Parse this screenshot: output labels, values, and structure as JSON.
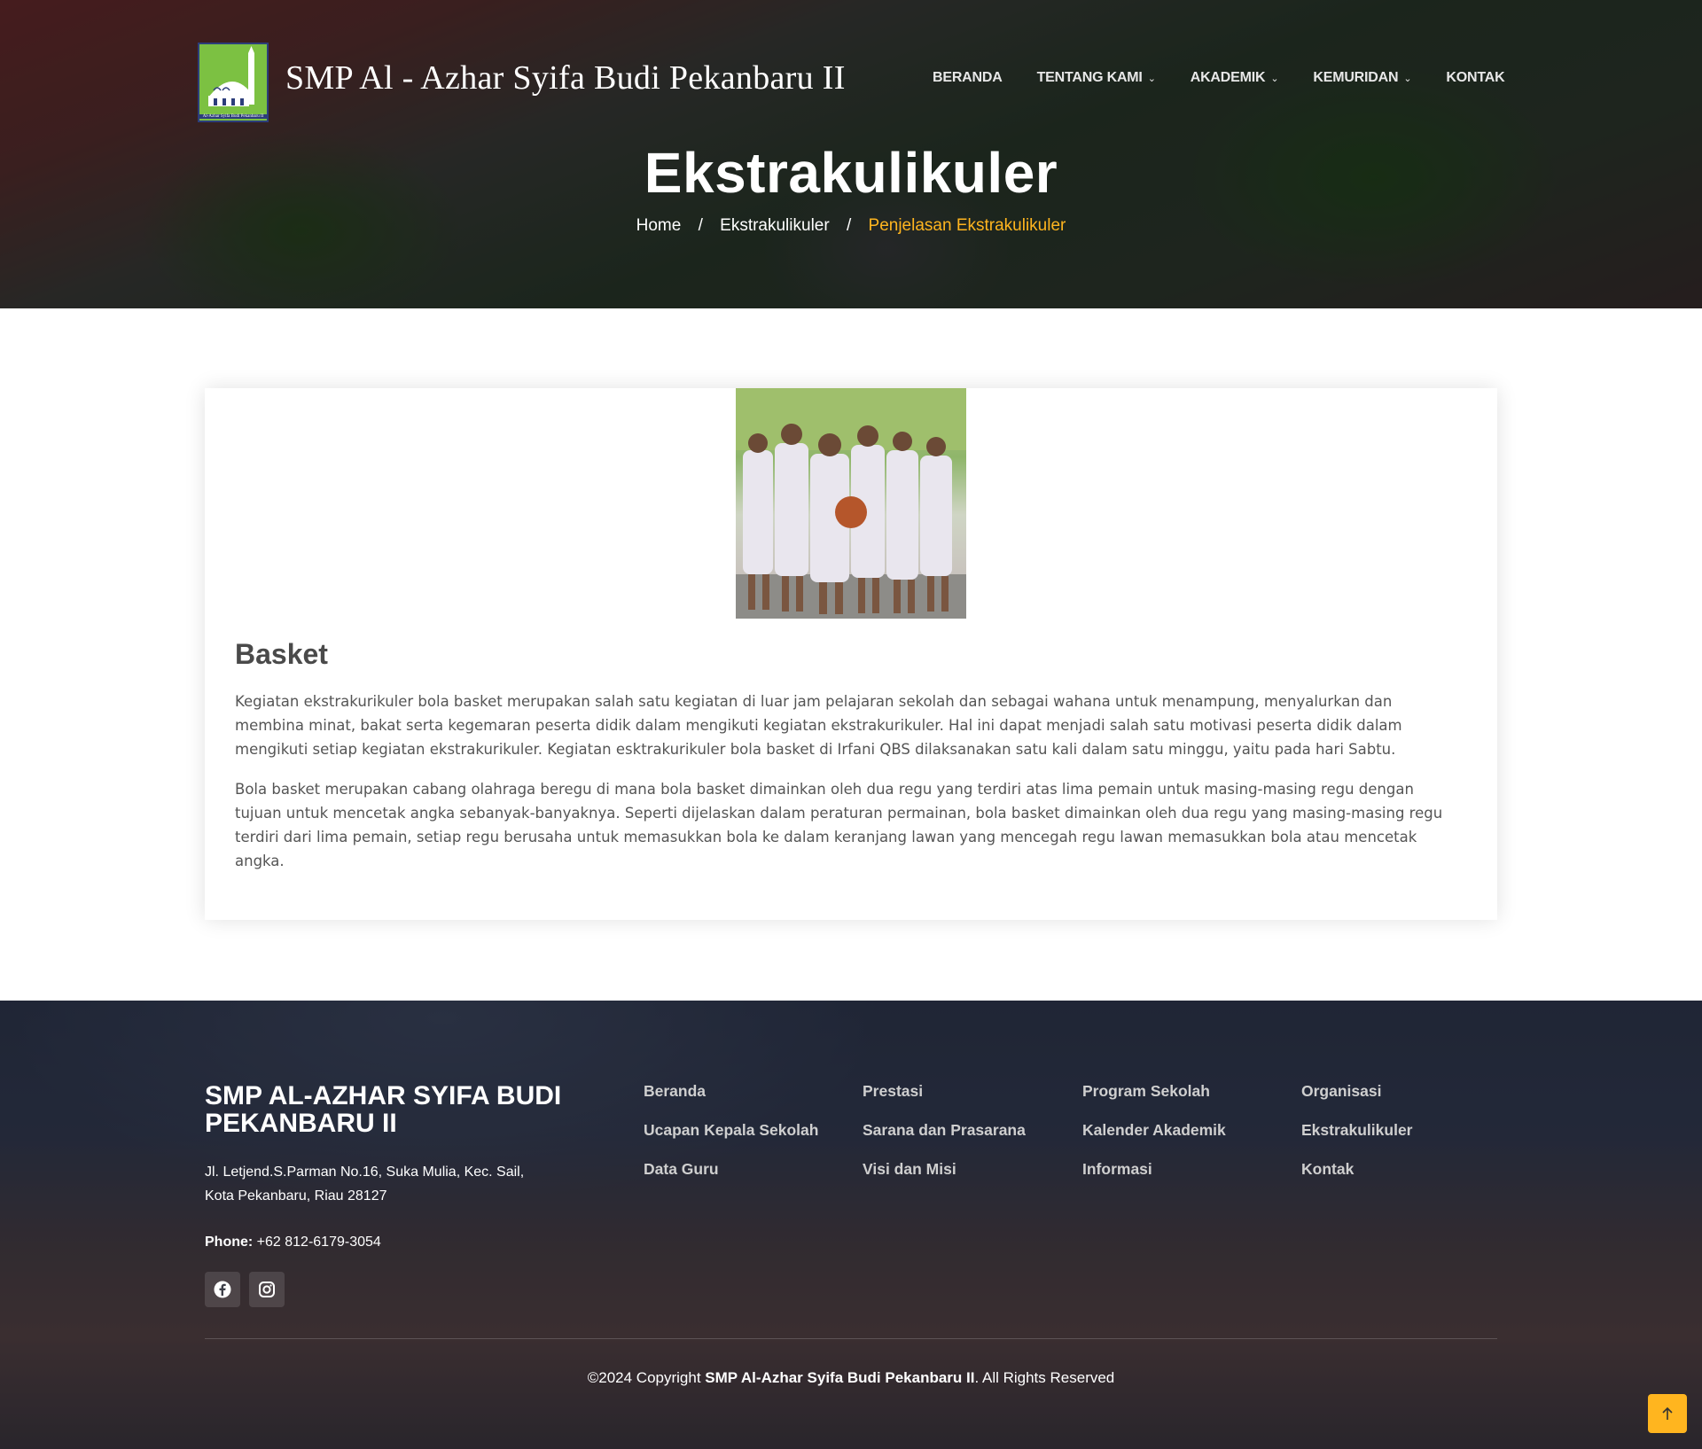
{
  "header": {
    "site_title": "SMP Al - Azhar Syifa Budi Pekanbaru II",
    "logo_caption": "Al-Azhar Syifa Budi Pekanbaru II",
    "nav": [
      {
        "label": "BERANDA",
        "has_dropdown": false
      },
      {
        "label": "TENTANG KAMI",
        "has_dropdown": true
      },
      {
        "label": "AKADEMIK",
        "has_dropdown": true
      },
      {
        "label": "KEMURIDAN",
        "has_dropdown": true
      },
      {
        "label": "KONTAK",
        "has_dropdown": false
      }
    ]
  },
  "hero": {
    "title": "Ekstrakulikuler",
    "breadcrumb": [
      "Home",
      "Ekstrakulikuler",
      "Penjelasan Ekstrakulikuler"
    ],
    "separator": "/"
  },
  "article": {
    "title": "Basket",
    "paragraphs": [
      "Kegiatan ekstrakurikuler bola basket merupakan salah satu kegiatan di luar jam pelajaran sekolah dan sebagai wahana untuk menampung, menyalurkan dan membina minat, bakat serta kegemaran peserta didik dalam mengikuti kegiatan ekstrakurikuler. Hal ini dapat menjadi salah satu motivasi peserta didik dalam mengikuti setiap kegiatan ekstrakurikuler. Kegiatan esktrakurikuler bola basket di Irfani QBS dilaksanakan satu kali dalam satu minggu, yaitu pada hari Sabtu.",
      "Bola basket merupakan cabang olahraga beregu di mana bola basket dimainkan oleh dua regu yang terdiri atas lima pemain untuk masing-masing regu dengan tujuan untuk mencetak angka sebanyak-banyaknya. Seperti dijelaskan dalam peraturan permainan, bola basket dimainkan oleh dua regu yang masing-masing regu terdiri dari lima pemain, setiap regu berusaha untuk memasukkan bola ke dalam keranjang lawan yang mencegah regu lawan memasukkan bola atau mencetak angka."
    ]
  },
  "footer": {
    "school_name": "SMP AL-AZHAR SYIFA BUDI PEKANBARU II",
    "address_line1": "Jl. Letjend.S.Parman No.16, Suka Mulia, Kec. Sail,",
    "address_line2": "Kota Pekanbaru, Riau 28127",
    "phone_label": "Phone:",
    "phone": "+62 812-6179-3054",
    "social": [
      "facebook-icon",
      "instagram-icon"
    ],
    "links": [
      [
        "Beranda",
        "Ucapan Kepala Sekolah",
        "Data Guru"
      ],
      [
        "Prestasi",
        "Sarana dan Prasarana",
        "Visi dan Misi"
      ],
      [
        "Program Sekolah",
        "Kalender Akademik",
        "Informasi"
      ],
      [
        "Organisasi",
        "Ekstrakulikuler",
        "Kontak"
      ]
    ],
    "copyright_prefix": "©2024 Copyright",
    "copyright_owner": "SMP Al-Azhar Syifa Budi Pekanbaru II",
    "copyright_suffix": ". All Rights Reserved"
  },
  "colors": {
    "accent": "#ffb51f",
    "logo_green": "#7cc142"
  }
}
